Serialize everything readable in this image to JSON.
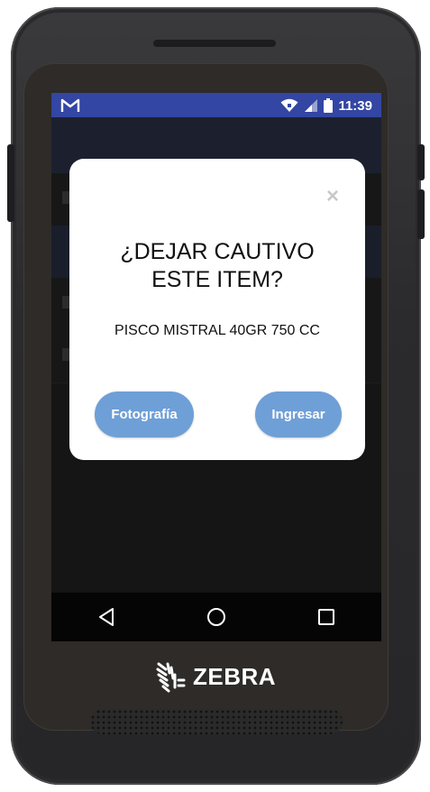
{
  "status_bar": {
    "time": "11:39",
    "left_icon": "gmail-m-icon",
    "color": "#3346a3"
  },
  "dialog": {
    "title": "¿DEJAR CAUTIVO\nESTE ITEM?",
    "product": "PISCO MISTRAL 40GR 750 CC",
    "close_symbol": "×",
    "buttons": {
      "photo": "Fotografía",
      "enter": "Ingresar"
    },
    "button_color": "#6f9fd7"
  },
  "device": {
    "brand": "ZEBRA"
  },
  "nav_bar": {
    "icons": [
      "back-icon",
      "home-icon",
      "recents-icon"
    ]
  }
}
